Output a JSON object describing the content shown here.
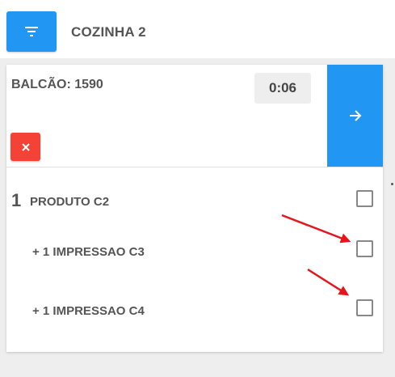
{
  "header": {
    "station_title": "COZINHA 2",
    "filter_icon": "filter-icon"
  },
  "order": {
    "label": "BALCÃO: 1590",
    "timer": "0:06",
    "cancel_icon": "close-icon",
    "advance_icon": "arrow-right-icon",
    "items": [
      {
        "qty": "1",
        "name": "PRODUTO C2",
        "checked": false
      },
      {
        "name": "+ 1 IMPRESSAO C3",
        "checked": false
      },
      {
        "name": "+ 1 IMPRESSAO C4",
        "checked": false
      }
    ]
  },
  "annotations": {
    "arrow_color": "#e8141c"
  },
  "colors": {
    "primary": "#2196f3",
    "danger": "#f44336",
    "panel_bg": "#eeeeee",
    "text": "#555555"
  }
}
